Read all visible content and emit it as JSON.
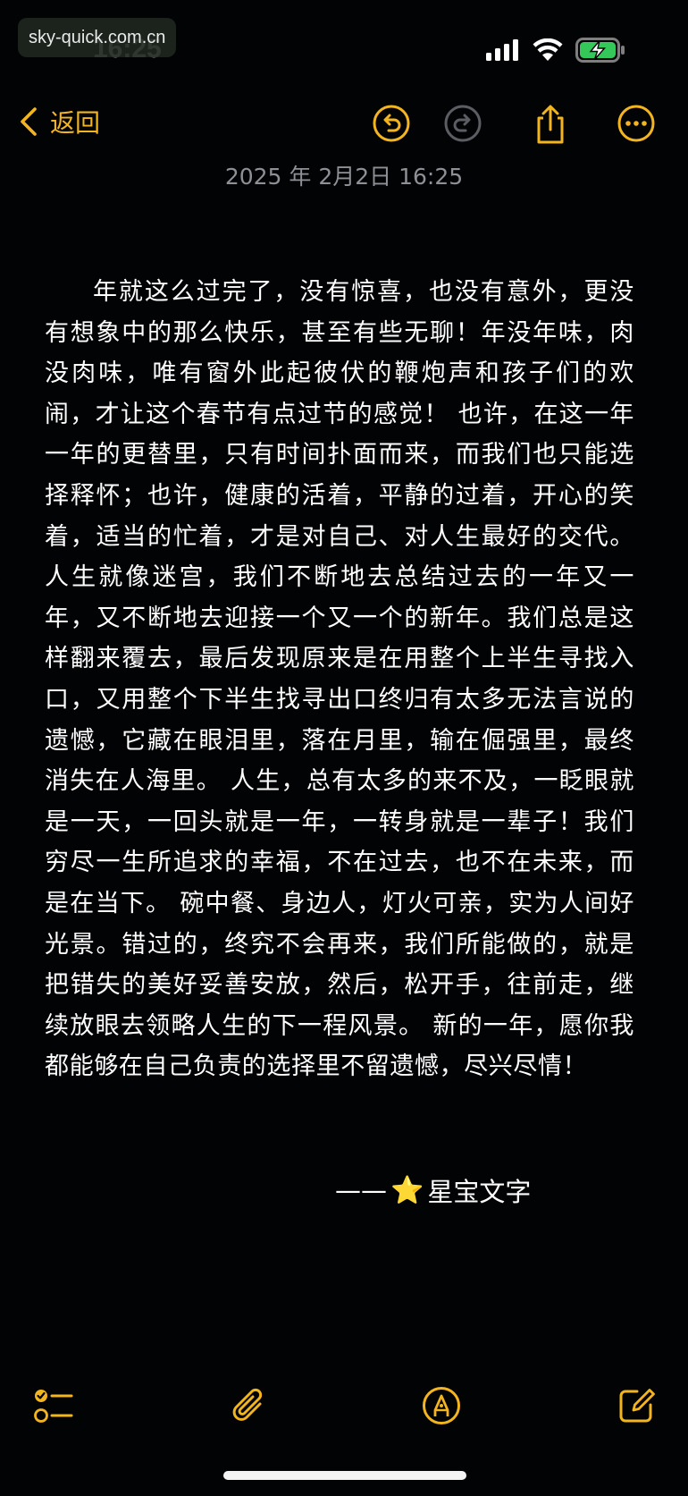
{
  "watermark": "sky-quick.com.cn",
  "status_bar": {
    "time": "16:25"
  },
  "nav": {
    "back_label": "返回"
  },
  "note": {
    "date": "2025 年 2月2日 16:25",
    "body": "年就这么过完了，没有惊喜，也没有意外，更没有想象中的那么快乐，甚至有些无聊！年没年味，肉没肉味，唯有窗外此起彼伏的鞭炮声和孩子们的欢闹，才让这个春节有点过节的感觉！ 也许，在这一年一年的更替里，只有时间扑面而来，而我们也只能选择释怀；也许，健康的活着，平静的过着，开心的笑着，适当的忙着，才是对自己、对人生最好的交代。 人生就像迷宫，我们不断地去总结过去的一年又一年，又不断地去迎接一个又一个的新年。我们总是这样翻来覆去，最后发现原来是在用整个上半生寻找入口，又用整个下半生找寻出口终归有太多无法言说的遗憾，它藏在眼泪里，落在月里，输在倔强里，最终消失在人海里。 人生，总有太多的来不及，一眨眼就是一天，一回头就是一年，一转身就是一辈子！我们穷尽一生所追求的幸福，不在过去，也不在未来，而是在当下。 碗中餐、身边人，灯火可亲，实为人间好光景。错过的，终究不会再来，我们所能做的，就是把错失的美好妥善安放，然后，松开手，往前走，继续放眼去领略人生的下一程风景。 新的一年，愿你我都能够在自己负责的选择里不留遗憾，尽兴尽情！",
    "signature_dash": "——",
    "signature_star": "⭐",
    "signature_name": "星宝文字"
  },
  "colors": {
    "accent": "#f2b51f",
    "background": "#020305",
    "date_text": "#8f9096",
    "disabled_icon": "#5c5d63"
  },
  "icons": {
    "back": "chevron-left-icon",
    "undo": "undo-icon",
    "redo": "redo-icon",
    "share": "share-icon",
    "more": "more-icon",
    "checklist": "checklist-icon",
    "attachment": "paperclip-icon",
    "markup": "pen-tip-icon",
    "compose": "compose-icon"
  }
}
